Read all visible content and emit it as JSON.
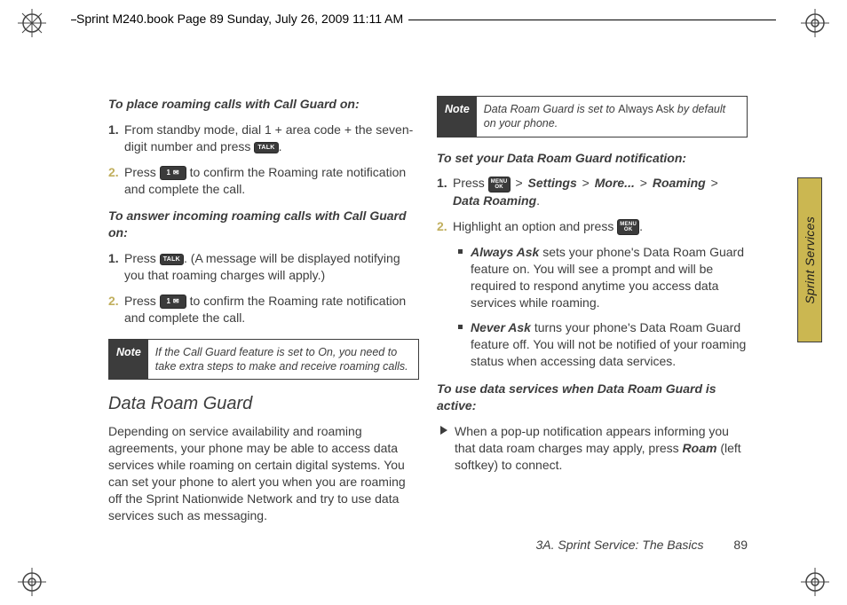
{
  "header": {
    "framemaker_info": "Sprint M240.book  Page 89  Sunday, July 26, 2009  11:11 AM"
  },
  "left": {
    "head1": "To place roaming calls with Call Guard on:",
    "s1": {
      "n": "1.",
      "a": "From standby mode, dial 1 + area code + the seven-digit number and press ",
      "key": "TALK",
      "b": "."
    },
    "s2": {
      "n": "2.",
      "a": "Press ",
      "key": "1  ✉",
      "b": " to confirm the Roaming rate notification and complete the call."
    },
    "head2": "To answer incoming roaming calls with Call Guard on:",
    "s3": {
      "n": "1.",
      "a": "Press ",
      "key": "TALK",
      "b": ". (A message will be displayed notifying you that roaming charges will apply.)"
    },
    "s4": {
      "n": "2.",
      "a": "Press ",
      "key": "1  ✉",
      "b": " to confirm the Roaming rate notification and complete the call."
    },
    "note": {
      "label": "Note",
      "text": "If the Call Guard feature is set to On, you need to take extra steps to make and receive roaming calls."
    },
    "subsection": "Data Roam Guard",
    "para": "Depending on service availability and roaming agreements, your phone may be able to access data services while roaming on certain digital systems. You can set your phone to alert you when you are roaming off the Sprint Nationwide Network and try to use data services such as messaging."
  },
  "right": {
    "note": {
      "label": "Note",
      "a": "Data Roam Guard is set to ",
      "bold": "Always Ask",
      "b": " by default on your phone."
    },
    "head1": "To set your Data Roam Guard notification:",
    "s1": {
      "n": "1.",
      "a": "Press ",
      "key": "MENU OK",
      "gt": " > ",
      "p1": "Settings",
      "p2": "More...",
      "p3": "Roaming",
      "p4": "Data Roaming",
      "end": "."
    },
    "s2": {
      "n": "2.",
      "a": "Highlight an option and press ",
      "key": "MENU OK",
      "b": "."
    },
    "sub1": {
      "bold": "Always Ask",
      "rest": " sets your phone's Data Roam Guard feature on. You will see a prompt and will be required to respond anytime you access data services while roaming."
    },
    "sub2": {
      "bold": "Never Ask",
      "rest": " turns your phone's Data Roam Guard feature off. You will not be notified of your roaming status when accessing data services."
    },
    "head2": "To use data services when Data Roam Guard is active:",
    "tri": {
      "a": "When a pop-up notification appears informing you that data roam charges may apply, press ",
      "bold": "Roam",
      "b": " (left softkey) to connect."
    }
  },
  "side_tab": "Sprint Services",
  "footer": {
    "section": "3A. Sprint Service: The Basics",
    "page": "89"
  }
}
